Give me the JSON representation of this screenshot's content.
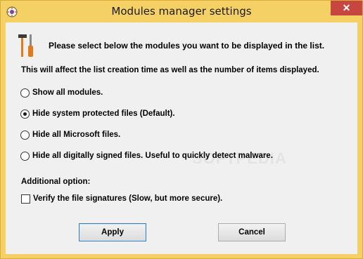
{
  "window": {
    "title": "Modules manager settings",
    "close_glyph": "✕"
  },
  "header": {
    "icon": "tools-icon",
    "text": "Please select below the modules you want to be displayed in the list."
  },
  "info_text": "This will affect the list creation time as well as the number of items displayed.",
  "options": [
    {
      "label": "Show all modules.",
      "checked": false
    },
    {
      "label": "Hide system protected files (Default).",
      "checked": true
    },
    {
      "label": "Hide all Microsoft files.",
      "checked": false
    },
    {
      "label": "Hide all digitally signed files. Useful to quickly detect malware.",
      "checked": false
    }
  ],
  "additional": {
    "label": "Additional option:",
    "checkbox_label": "Verify the file signatures (Slow, but more secure).",
    "checked": false
  },
  "buttons": {
    "apply": "Apply",
    "cancel": "Cancel"
  },
  "watermark": "SOFTPEDIA",
  "colors": {
    "title_bar": "#f5d064",
    "close_button": "#c7463f",
    "client_bg": "#f0f0f0"
  }
}
